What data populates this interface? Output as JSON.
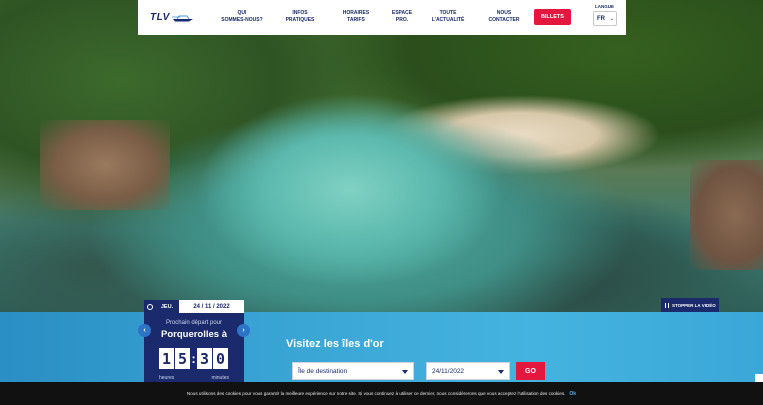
{
  "header": {
    "logo_text": "TLV",
    "nav": [
      {
        "label": "QUI\nSOMMES-NOUS?"
      },
      {
        "label": "INFOS\nPRATIQUES"
      },
      {
        "label": "HORAIRES\nTARIFS"
      },
      {
        "label": "ESPACE\nPRO."
      },
      {
        "label": "TOUTE\nL'ACTUALITÉ"
      },
      {
        "label": "NOUS\nCONTACTER"
      }
    ],
    "tickets_button": "BILLETS",
    "language_label": "LANGUE",
    "language_value": "FR"
  },
  "video": {
    "stop_label": "STOPPER LA VIDÉO"
  },
  "departure": {
    "day": "JEU.",
    "date": "24 / 11 / 2022",
    "next_label": "Prochain départ pour",
    "island": "Porquerolles à",
    "time_digits": [
      "1",
      "5",
      "3",
      "0"
    ],
    "hours_label": "heures",
    "minutes_label": "minutes"
  },
  "search": {
    "title": "Visitez les îles d'or",
    "destination_placeholder": "Île de destination",
    "date_value": "24/11/2022",
    "go_label": "GO"
  },
  "cookie": {
    "text": "Nous utilisons des cookies pour vous garantir la meilleure expérience sur notre site. Si vous continuez à utiliser ce dernier, nous considérerons que vous acceptez l'utilisation des cookies.",
    "ok_label": "Ok"
  },
  "colors": {
    "navy": "#1a2a6c",
    "red": "#e4173f",
    "band": "#3aa6d6"
  }
}
